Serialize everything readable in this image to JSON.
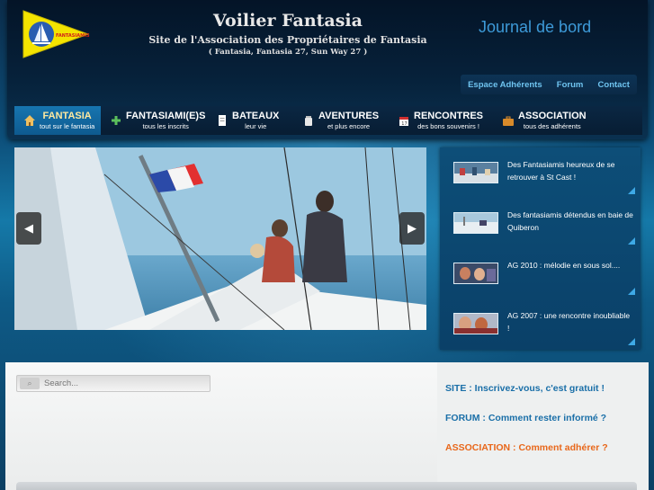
{
  "header": {
    "logo_text": "FANTASIAMIS",
    "title": "Voilier Fantasia",
    "subtitle": "Site de l'Association des Propriétaires de Fantasia",
    "models": "( Fantasia, Fantasia 27, Sun Way 27 )",
    "journal": "Journal de bord"
  },
  "toplinks": [
    "Espace Adhérents",
    "Forum",
    "Contact"
  ],
  "nav": [
    {
      "label": "FANTASIA",
      "sub": "tout sur le fantasia",
      "icon": "home-icon",
      "active": true
    },
    {
      "label": "FANTASIAMI(E)S",
      "sub": "tous les inscrits",
      "icon": "plus-icon"
    },
    {
      "label": "BATEAUX",
      "sub": "leur vie",
      "icon": "document-icon"
    },
    {
      "label": "AVENTURES",
      "sub": "et plus encore",
      "icon": "jar-icon"
    },
    {
      "label": "RENCONTRES",
      "sub": "des bons souvenirs !",
      "icon": "calendar-icon"
    },
    {
      "label": "ASSOCIATION",
      "sub": "tous des adhérents",
      "icon": "briefcase-icon"
    }
  ],
  "slider": {
    "prev": "◀",
    "next": "▶"
  },
  "news": [
    {
      "text": "Des Fantasiamis heureux de se retrouver à St Cast !"
    },
    {
      "text": "Des fantasiamis détendus en baie de Quiberon"
    },
    {
      "text": "AG 2010 : mélodie en sous sol...."
    },
    {
      "text": "AG 2007 : une rencontre inoubliable !"
    }
  ],
  "search": {
    "placeholder": "Search..."
  },
  "cta": [
    {
      "text": "SITE : Inscrivez-vous, c'est gratuit !",
      "color": "#1a6fa8"
    },
    {
      "text": "FORUM : Comment rester informé ?",
      "color": "#1a6fa8"
    },
    {
      "text": "ASSOCIATION : Comment adhérer ?",
      "color": "#e8671a"
    }
  ]
}
